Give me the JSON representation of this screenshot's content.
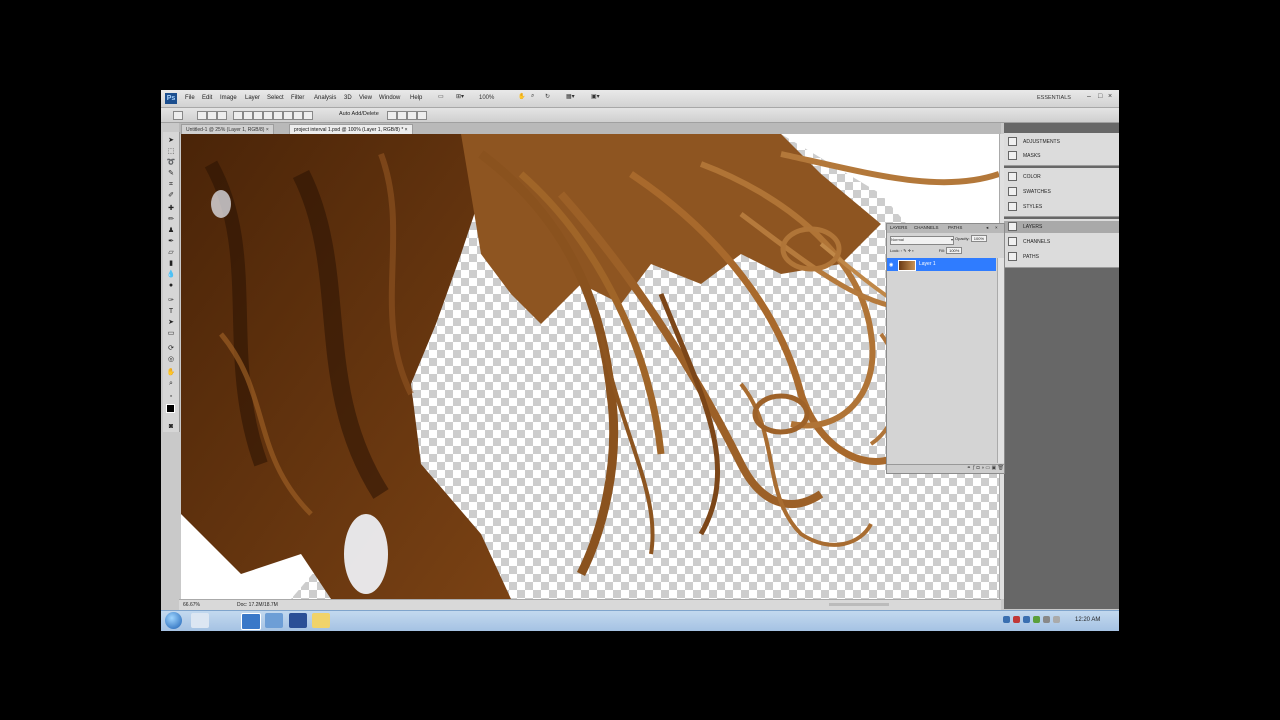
{
  "menubar": {
    "app_icon": "Ps",
    "items": [
      "File",
      "Edit",
      "Image",
      "Layer",
      "Select",
      "Filter",
      "Analysis",
      "3D",
      "View",
      "Window",
      "Help"
    ],
    "zoom": "100%",
    "workspace": "ESSENTIALS",
    "window_controls": [
      "–",
      "□",
      "×"
    ]
  },
  "optionsbar": {
    "auto_add_delete": "Auto Add/Delete"
  },
  "tabs": [
    {
      "label": "Untitled-1 @ 25% (Layer 1, RGB/8) ×"
    },
    {
      "label": "project interval 1.psd @ 100% (Layer 1, RGB/8) * ×"
    }
  ],
  "status": {
    "zoom": "66.67%",
    "doc": "Doc: 17.2M/18.7M"
  },
  "rightdock": {
    "group1": [
      "ADJUSTMENTS",
      "MASKS"
    ],
    "group2": [
      "COLOR",
      "SWATCHES",
      "STYLES"
    ],
    "group3": [
      "LAYERS",
      "CHANNELS",
      "PATHS"
    ]
  },
  "layers_panel": {
    "tabs": [
      "LAYERS",
      "CHANNELS",
      "PATHS"
    ],
    "blend_mode": "Normal",
    "opacity_label": "Opacity:",
    "opacity_value": "100%",
    "lock_label": "Lock:",
    "fill_label": "Fill:",
    "fill_value": "100%",
    "layer_name": "Layer 1"
  },
  "taskbar": {
    "clock": "12:20 AM"
  },
  "colors": {
    "selection": "#2f7cff",
    "hair_dark": "#5a3010",
    "hair_mid": "#9c6227",
    "hair_light": "#c99458"
  }
}
